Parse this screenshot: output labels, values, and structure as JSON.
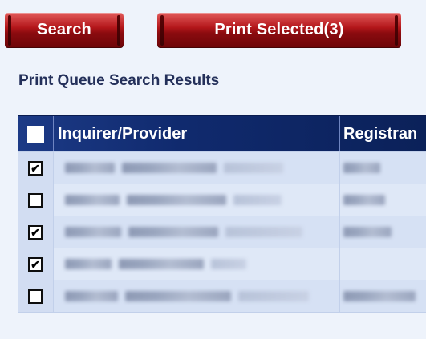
{
  "toolbar": {
    "search_label": "Search",
    "print_selected_label": "Print Selected(3)"
  },
  "section_title": "Print Queue Search Results",
  "table": {
    "columns": [
      "Inquirer/Provider",
      "Registran"
    ],
    "select_all_checked": false,
    "rows": [
      {
        "checked": true,
        "inquirer_provider": "",
        "registrant": ""
      },
      {
        "checked": false,
        "inquirer_provider": "",
        "registrant": ""
      },
      {
        "checked": true,
        "inquirer_provider": "",
        "registrant": ""
      },
      {
        "checked": true,
        "inquirer_provider": "",
        "registrant": ""
      },
      {
        "checked": false,
        "inquirer_provider": "",
        "registrant": ""
      }
    ]
  },
  "colors": {
    "button_red": "#8a0b0f",
    "header_blue": "#102a6e",
    "row_bg": "#d6e1f4",
    "title_text": "#24305a"
  }
}
